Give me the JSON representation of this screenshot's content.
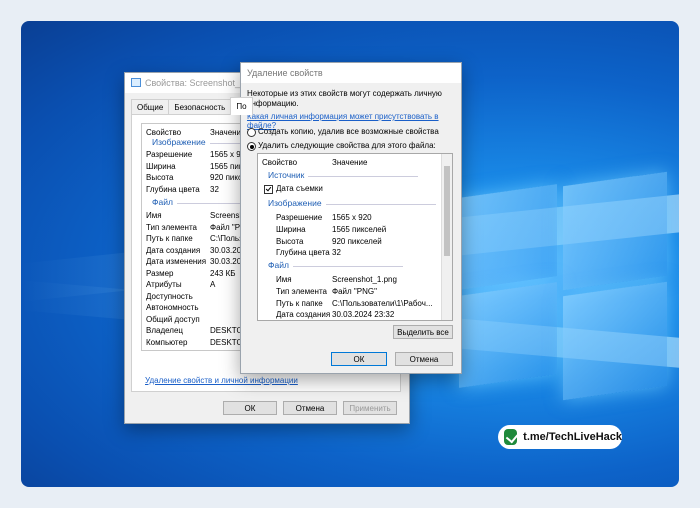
{
  "props_window": {
    "title": "Свойства: Screenshot_1.png",
    "tabs": [
      "Общие",
      "Безопасность",
      "По"
    ],
    "col_property": "Свойство",
    "col_value": "Значение",
    "groups": {
      "image": "Изображение",
      "file": "Файл"
    },
    "image_rows": [
      {
        "k": "Разрешение",
        "v": "1565 x 920"
      },
      {
        "k": "Ширина",
        "v": "1565 пиксе"
      },
      {
        "k": "Высота",
        "v": "920 пиксел"
      },
      {
        "k": "Глубина цвета",
        "v": "32"
      }
    ],
    "file_rows": [
      {
        "k": "Имя",
        "v": "Screensho"
      },
      {
        "k": "Тип элемента",
        "v": "Файл \"PNG"
      },
      {
        "k": "Путь к папке",
        "v": "C:\\Пользо"
      },
      {
        "k": "Дата создания",
        "v": "30.03.2024"
      },
      {
        "k": "Дата изменения",
        "v": "30.03.2024"
      },
      {
        "k": "Размер",
        "v": "243 КБ"
      },
      {
        "k": "Атрибуты",
        "v": "A"
      },
      {
        "k": "Доступность",
        "v": ""
      },
      {
        "k": "Автономность",
        "v": ""
      },
      {
        "k": "Общий доступ",
        "v": ""
      },
      {
        "k": "Владелец",
        "v": "DESKTOP"
      },
      {
        "k": "Компьютер",
        "v": "DESKTOP"
      }
    ],
    "remove_link": "Удаление свойств и личной информации",
    "ok": "ОК",
    "cancel": "Отмена",
    "apply": "Применить"
  },
  "remove_dialog": {
    "title": "Удаление свойств",
    "intro": "Некоторые из этих свойств могут содержать личную информацию.",
    "link": "Какая личная информация может присутствовать в файле?",
    "option_copy": "Создать копию, удалив все возможные свойства",
    "option_remove": "Удалить следующие свойства для этого файла:",
    "col_property": "Свойство",
    "col_value": "Значение",
    "groups": {
      "source": "Источник",
      "image": "Изображение",
      "file": "Файл"
    },
    "source_rows": [
      {
        "k": "Дата съемки",
        "v": ""
      }
    ],
    "image_rows": [
      {
        "k": "Разрешение",
        "v": "1565 x 920"
      },
      {
        "k": "Ширина",
        "v": "1565 пикселей"
      },
      {
        "k": "Высота",
        "v": "920 пикселей"
      },
      {
        "k": "Глубина цвета",
        "v": "32"
      }
    ],
    "file_rows": [
      {
        "k": "Имя",
        "v": "Screenshot_1.png"
      },
      {
        "k": "Тип элемента",
        "v": "Файл \"PNG\""
      },
      {
        "k": "Путь к папке",
        "v": "C:\\Пользователи\\1\\Рабоч..."
      },
      {
        "k": "Дата создания",
        "v": "30.03.2024 23:32"
      }
    ],
    "select_all": "Выделить все",
    "ok": "ОК",
    "cancel": "Отмена"
  },
  "watermark": {
    "text": "t.me/TechLiveHack",
    "icon": "check-icon",
    "color": "#1f8a3b"
  },
  "colors": {
    "accent": "#0078d7",
    "link": "#1a5fc8",
    "group": "#1e5eb4"
  }
}
